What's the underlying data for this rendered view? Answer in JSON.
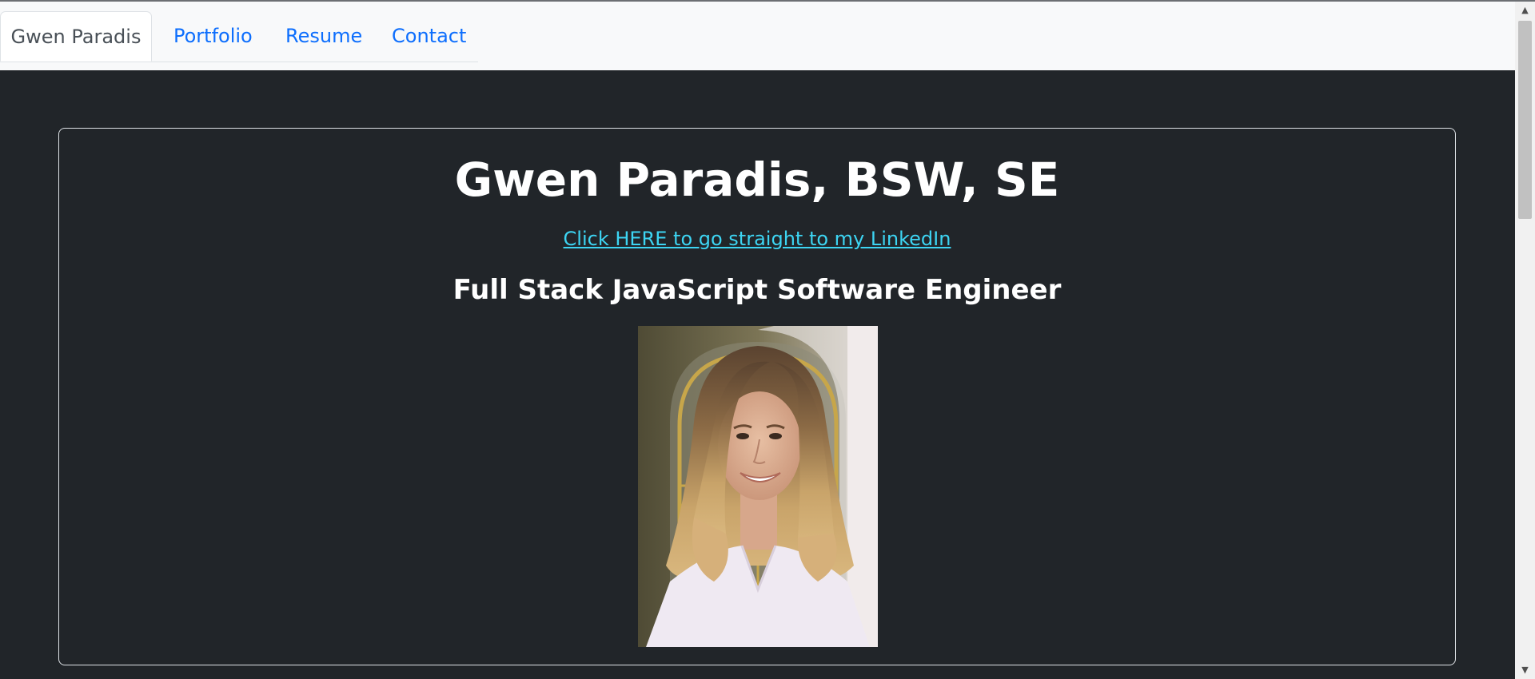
{
  "nav": {
    "tabs": [
      {
        "label": "Gwen Paradis",
        "active": true
      },
      {
        "label": "Portfolio",
        "active": false
      },
      {
        "label": "Resume",
        "active": false
      },
      {
        "label": "Contact",
        "active": false
      }
    ]
  },
  "main": {
    "title": "Gwen Paradis, BSW, SE",
    "linkedin_link": "Click HERE to go straight to my LinkedIn",
    "subtitle": "Full Stack JavaScript Software Engineer",
    "photo_alt": "Gwen Paradis"
  },
  "colors": {
    "background": "#212529",
    "navbar": "#f8f9fa",
    "link": "#0d6efd",
    "linkedin_link": "#3dd5f3",
    "text": "#ffffff"
  }
}
